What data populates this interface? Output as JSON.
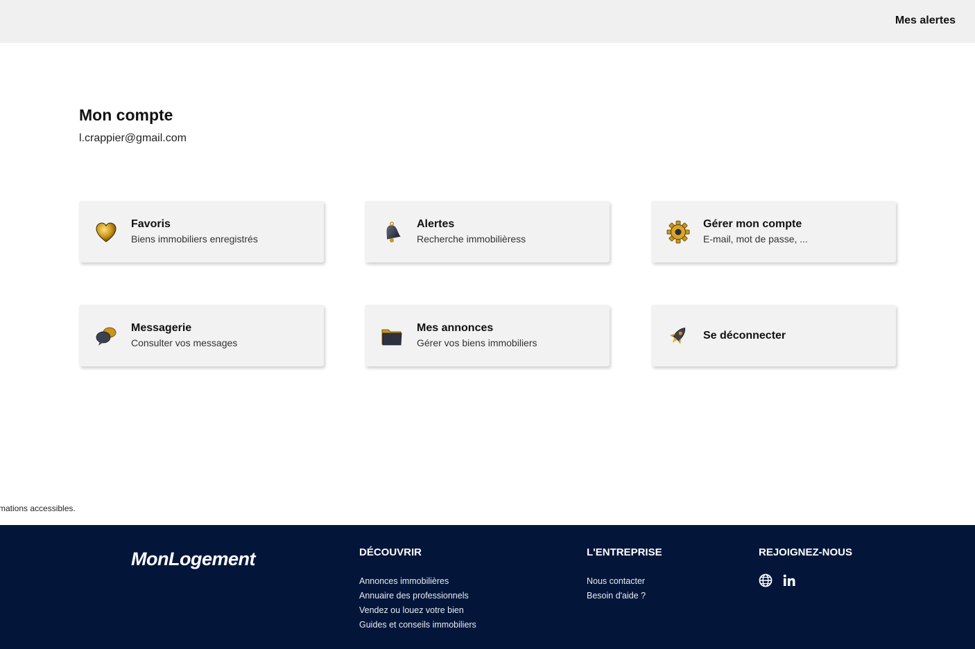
{
  "header": {
    "alerts_label": "Mes alertes"
  },
  "account": {
    "title": "Mon compte",
    "email": "l.crappier@gmail.com"
  },
  "cards": [
    {
      "title": "Favoris",
      "subtitle": "Biens immobiliers enregistrés",
      "icon": "gold-heart-icon"
    },
    {
      "title": "Alertes",
      "subtitle": "Recherche immobilièress",
      "icon": "bell-icon"
    },
    {
      "title": "Gérer mon compte",
      "subtitle": "E-mail, mot de passe, ...",
      "icon": "gear-icon"
    },
    {
      "title": "Messagerie",
      "subtitle": "Consulter vos messages",
      "icon": "chat-bubbles-icon"
    },
    {
      "title": "Mes annonces",
      "subtitle": "Gérer vos biens immobiliers",
      "icon": "folder-icon"
    },
    {
      "title": "Se déconnecter",
      "subtitle": "",
      "icon": "rocket-icon"
    }
  ],
  "notice": "rmations accessibles.",
  "footer": {
    "logo": "MonLogement",
    "discover": {
      "title": "DÉCOUVRIR",
      "links": [
        "Annonces immobilières",
        "Annuaire des professionnels",
        "Vendez ou louez votre bien",
        "Guides et conseils immobiliers"
      ]
    },
    "company": {
      "title": "L'ENTREPRISE",
      "links": [
        "Nous contacter",
        "Besoin d'aide ?"
      ]
    },
    "join": {
      "title": "REJOIGNEZ-NOUS",
      "icons": [
        "globe-icon",
        "linkedin-icon"
      ]
    }
  },
  "colors": {
    "footer_bg": "#03163a",
    "topbar_bg": "#f0f0f0",
    "card_bg": "#f2f2f2",
    "accent_gold": "#c9951a"
  }
}
